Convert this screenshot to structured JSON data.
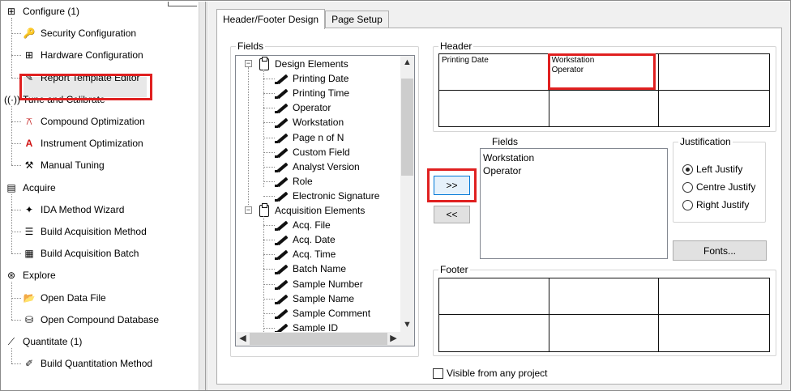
{
  "nav": {
    "items": [
      {
        "label": "Configure  (1)",
        "icon": "grid-config-icon",
        "glyph": "⊞",
        "level": 0
      },
      {
        "label": "Security Configuration",
        "icon": "key-icon",
        "glyph": "🔑",
        "level": 1
      },
      {
        "label": "Hardware Configuration",
        "icon": "hardware-grid-icon",
        "glyph": "⊞",
        "level": 1
      },
      {
        "label": "Report Template Editor",
        "icon": "report-edit-icon",
        "glyph": "✎",
        "level": 1
      },
      {
        "label": "Tune and Calibrate",
        "icon": "signal-icon",
        "glyph": "((·))",
        "level": 0
      },
      {
        "label": "Compound Optimization",
        "icon": "compound-icon",
        "glyph": "⚻",
        "level": 1
      },
      {
        "label": "Instrument Optimization",
        "icon": "instrument-icon",
        "glyph": "A",
        "level": 1
      },
      {
        "label": "Manual Tuning",
        "icon": "tuning-icon",
        "glyph": "⚒",
        "level": 1
      },
      {
        "label": "Acquire",
        "icon": "acquire-icon",
        "glyph": "▤",
        "level": 0
      },
      {
        "label": "IDA Method Wizard",
        "icon": "wizard-icon",
        "glyph": "✦",
        "level": 1
      },
      {
        "label": "Build Acquisition Method",
        "icon": "method-icon",
        "glyph": "☰",
        "level": 1
      },
      {
        "label": "Build Acquisition Batch",
        "icon": "batch-icon",
        "glyph": "▦",
        "level": 1
      },
      {
        "label": "Explore",
        "icon": "explore-icon",
        "glyph": "⊛",
        "level": 0
      },
      {
        "label": "Open Data File",
        "icon": "folder-icon",
        "glyph": "📂",
        "level": 1
      },
      {
        "label": "Open Compound Database",
        "icon": "database-icon",
        "glyph": "⛁",
        "level": 1
      },
      {
        "label": "Quantitate  (1)",
        "icon": "quantitate-icon",
        "glyph": "⟋",
        "level": 0
      },
      {
        "label": "Build Quantitation Method",
        "icon": "quant-method-icon",
        "glyph": "✐",
        "level": 1
      }
    ]
  },
  "tabs": [
    "Header/Footer Design",
    "Page Setup"
  ],
  "fields_group": {
    "title": "Fields",
    "tree": [
      {
        "label": "Design Elements",
        "kind": "folder"
      },
      {
        "label": "Printing Date",
        "kind": "leaf"
      },
      {
        "label": "Printing Time",
        "kind": "leaf"
      },
      {
        "label": "Operator",
        "kind": "leaf"
      },
      {
        "label": "Workstation",
        "kind": "leaf"
      },
      {
        "label": "Page n of N",
        "kind": "leaf"
      },
      {
        "label": "Custom Field",
        "kind": "leaf"
      },
      {
        "label": "Analyst Version",
        "kind": "leaf"
      },
      {
        "label": "Role",
        "kind": "leaf"
      },
      {
        "label": "Electronic Signature",
        "kind": "leaf"
      },
      {
        "label": "Acquisition Elements",
        "kind": "folder"
      },
      {
        "label": "Acq. File",
        "kind": "leaf"
      },
      {
        "label": "Acq. Date",
        "kind": "leaf"
      },
      {
        "label": "Acq. Time",
        "kind": "leaf"
      },
      {
        "label": "Batch Name",
        "kind": "leaf"
      },
      {
        "label": "Sample Number",
        "kind": "leaf"
      },
      {
        "label": "Sample Name",
        "kind": "leaf"
      },
      {
        "label": "Sample Comment",
        "kind": "leaf"
      },
      {
        "label": "Sample ID",
        "kind": "leaf"
      }
    ]
  },
  "header": {
    "title": "Header",
    "cells": [
      {
        "lines": [
          "Printing Date"
        ]
      },
      {
        "lines": [
          "Workstation",
          "Operator"
        ]
      },
      {
        "lines": []
      },
      {
        "lines": []
      },
      {
        "lines": []
      },
      {
        "lines": []
      }
    ]
  },
  "cell_fields": {
    "title": "Fields",
    "items": [
      "Workstation",
      "Operator"
    ]
  },
  "buttons": {
    "add": ">>",
    "remove": "<<",
    "fonts": "Fonts..."
  },
  "justification": {
    "title": "Justification",
    "options": [
      "Left Justify",
      "Centre Justify",
      "Right Justify"
    ],
    "selected": "Left Justify"
  },
  "footer": {
    "title": "Footer",
    "cells": [
      {
        "lines": []
      },
      {
        "lines": []
      },
      {
        "lines": []
      },
      {
        "lines": []
      },
      {
        "lines": []
      },
      {
        "lines": []
      }
    ]
  },
  "visible_checkbox": {
    "label": "Visible from any project",
    "checked": false
  },
  "colors": {
    "highlight": "#e02020",
    "selection_bg": "#e8e8e8",
    "button_focus": "#0078d7"
  }
}
